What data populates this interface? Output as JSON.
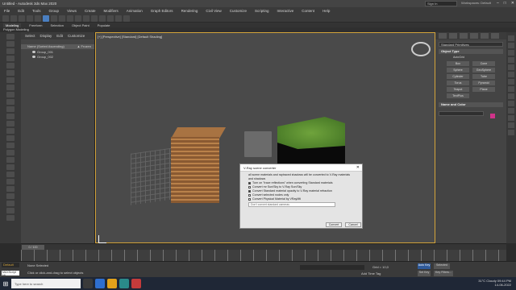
{
  "window": {
    "title": "Untitled - Autodesk 3ds Max 2020"
  },
  "menu": [
    "File",
    "Edit",
    "Tools",
    "Group",
    "Views",
    "Create",
    "Modifiers",
    "Animation",
    "Graph Editors",
    "Rendering",
    "Civil View",
    "Customize",
    "Scripting",
    "Interactive",
    "Content",
    "Help"
  ],
  "signin": "Sign In",
  "workspace": {
    "label": "Workspaces:",
    "value": "Default"
  },
  "ribbon": {
    "tabs": [
      "Modeling",
      "Freeform",
      "Selection",
      "Object Paint",
      "Populate"
    ],
    "active": "Modeling",
    "sub": "Polygon Modeling"
  },
  "scene": {
    "tabs": [
      "Select",
      "Display",
      "Edit",
      "Customize"
    ],
    "header": "Name (Sorted Ascending)",
    "header_right": "▲ Frozen",
    "rows": [
      "Group_001",
      "Group_002"
    ]
  },
  "viewport": {
    "label": "[+] [Perspective] [Standard] [Default Shading]"
  },
  "dialog": {
    "title": "V-Ray scene converter",
    "intro": "all scene materials and raytraced shadows will be converted to V-Ray materials and shadows",
    "options": [
      {
        "label": "Turn on \"trace reflections\" when converting Standard materials",
        "checked": true
      },
      {
        "label": "Convert mr Sun/Sky to V-Ray Sun/Sky",
        "checked": false
      },
      {
        "label": "Convert Standard material opacity to V-Ray material refraction",
        "checked": true
      },
      {
        "label": "Convert selected nodes only",
        "checked": false
      },
      {
        "label": "Convert Physical Material by VRayMtl",
        "checked": false
      }
    ],
    "select_placeholder": "Don't convert standard cameras",
    "convert": "Convert",
    "cancel": "Cancel"
  },
  "command": {
    "combo": "Standard Primitives",
    "object_type": "Object Type",
    "autogrid": "AutoGrid",
    "buttons": [
      "Box",
      "Cone",
      "Sphere",
      "GeoSphere",
      "Cylinder",
      "Tube",
      "Torus",
      "Pyramid",
      "Teapot",
      "Plane",
      "TextPlus"
    ],
    "name_color": "Name and Color"
  },
  "timeline": {
    "slider": "0 / 100"
  },
  "status": {
    "selection": "None Selected",
    "prompt": "Click or click-and-drag to select objects",
    "maxscript": "MAXScript Mi",
    "default_layer": "Default",
    "grid": "Grid = 10,0",
    "add_time_tag": "Add Time Tag",
    "auto_key": "Auto Key",
    "set_key": "Set Key",
    "selected": "Selected",
    "key_filters": "Key Filters..."
  },
  "taskbar": {
    "search": "Type here to search",
    "weather": "31°C Cloudy",
    "time": "09:44 PM",
    "date": "14-06-2022"
  }
}
